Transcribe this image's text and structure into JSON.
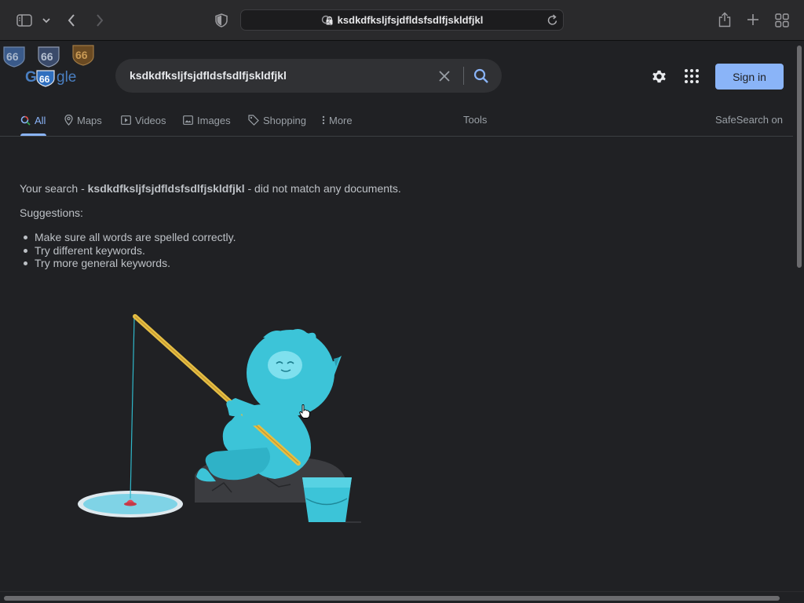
{
  "browser": {
    "url": "ksdkdfksljfsjdfldsfsdlfjskldfjkl"
  },
  "header": {
    "logo_alt": "Google",
    "search_query": "ksdkdfksljfsjdfldsfsdlfjskldfjkl",
    "sign_in_label": "Sign in"
  },
  "tabs": [
    {
      "label": "All",
      "icon": "search-icon",
      "active": true
    },
    {
      "label": "Maps",
      "icon": "map-pin-icon"
    },
    {
      "label": "Videos",
      "icon": "play-icon"
    },
    {
      "label": "Images",
      "icon": "image-icon"
    },
    {
      "label": "Shopping",
      "icon": "tag-icon"
    },
    {
      "label": "More",
      "icon": "more-vert-icon"
    }
  ],
  "tools_label": "Tools",
  "safesearch_label": "SafeSearch on",
  "result": {
    "prefix": "Your search - ",
    "query": "ksdkdfksljfsjdfldsfsdlfjskldfjkl",
    "suffix": " - did not match any documents.",
    "suggestions_title": "Suggestions:",
    "suggestions": [
      "Make sure all words are spelled correctly.",
      "Try different keywords.",
      "Try more general keywords."
    ]
  },
  "colors": {
    "accent": "#8ab4f8",
    "page_bg": "#202124",
    "search_bg": "#303134"
  }
}
